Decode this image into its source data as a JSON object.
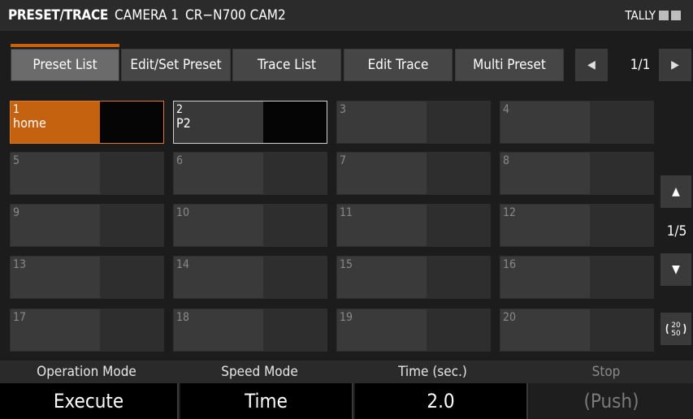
{
  "header": {
    "mode": "PRESET/TRACE",
    "camera": "CAMERA 1",
    "model": "CR−N700 CAM2",
    "tally": "TALLY"
  },
  "tabs": [
    {
      "label": "Preset List",
      "active": true
    },
    {
      "label": "Edit/Set Preset",
      "active": false
    },
    {
      "label": "Trace List",
      "active": false
    },
    {
      "label": "Edit Trace",
      "active": false
    },
    {
      "label": "Multi Preset",
      "active": false
    }
  ],
  "pager": {
    "page": "1/1",
    "prev_icon": "left-arrow-icon",
    "next_icon": "right-arrow-icon"
  },
  "presets": [
    {
      "num": "1",
      "name": "home",
      "state": "selected"
    },
    {
      "num": "2",
      "name": "P2",
      "state": "outlined"
    },
    {
      "num": "3",
      "name": ""
    },
    {
      "num": "4",
      "name": ""
    },
    {
      "num": "5",
      "name": ""
    },
    {
      "num": "6",
      "name": ""
    },
    {
      "num": "7",
      "name": ""
    },
    {
      "num": "8",
      "name": ""
    },
    {
      "num": "9",
      "name": ""
    },
    {
      "num": "10",
      "name": ""
    },
    {
      "num": "11",
      "name": ""
    },
    {
      "num": "12",
      "name": ""
    },
    {
      "num": "13",
      "name": ""
    },
    {
      "num": "14",
      "name": ""
    },
    {
      "num": "15",
      "name": ""
    },
    {
      "num": "16",
      "name": ""
    },
    {
      "num": "17",
      "name": ""
    },
    {
      "num": "18",
      "name": ""
    },
    {
      "num": "19",
      "name": ""
    },
    {
      "num": "20",
      "name": ""
    }
  ],
  "side": {
    "page": "1/5",
    "up_icon": "up-arrow-icon",
    "down_icon": "down-arrow-icon",
    "toggle_icon": "20-50-toggle-icon",
    "toggle_top": "20",
    "toggle_bottom": "50"
  },
  "bottom": {
    "operation_mode_label": "Operation Mode",
    "operation_mode_value": "Execute",
    "speed_mode_label": "Speed Mode",
    "speed_mode_value": "Time",
    "time_label": "Time (sec.)",
    "time_value": "2.0",
    "stop_label": "Stop",
    "stop_value": "(Push)"
  },
  "colors": {
    "accent": "#c46210",
    "background": "#1c1c1c"
  }
}
